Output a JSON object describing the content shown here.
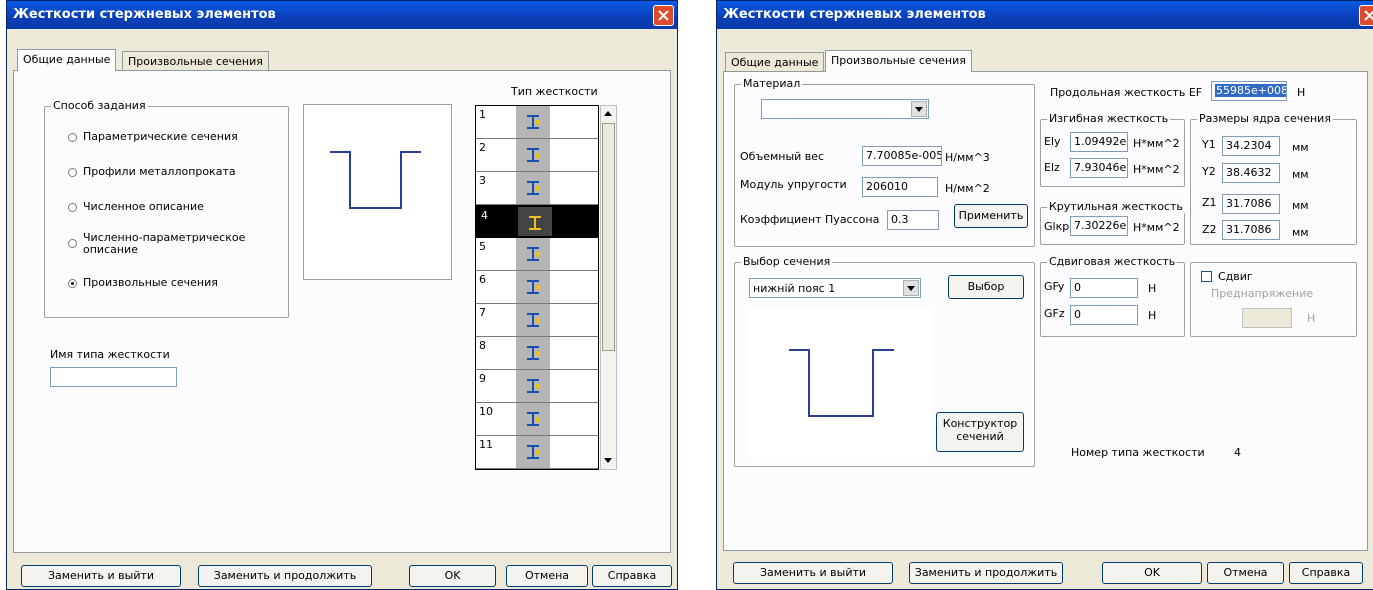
{
  "colors": {
    "title_bar": "#0a3fb8",
    "close": "#e04b2e",
    "section_line": "#2a3f9a",
    "icon_yellow": "#e8c020",
    "icon_blue": "#1a4fb0"
  },
  "left": {
    "title": "Жесткости стержневых элементов",
    "tabs": [
      "Общие данные",
      "Произвольные сечения"
    ],
    "method_group": "Способ задания",
    "options": [
      "Параметрические сечения",
      "Профили металлопроката",
      "Численное описание",
      "Численно-параметрическое",
      "описание",
      "Произвольные сечения"
    ],
    "selected_option": "Произвольные сечения",
    "type_header": "Тип жесткости",
    "rows": [
      "1",
      "2",
      "3",
      "4",
      "5",
      "6",
      "7",
      "8",
      "9",
      "10",
      "11"
    ],
    "selected_row": "4",
    "name_label": "Имя типа жесткости",
    "name_value": "",
    "buttons": {
      "replace_exit": "Заменить и выйти",
      "replace_continue": "Заменить и продолжить",
      "ok": "OK",
      "cancel": "Отмена",
      "help": "Справка"
    }
  },
  "right": {
    "title": "Жесткости стержневых элементов",
    "tabs": [
      "Общие данные",
      "Произвольные сечения"
    ],
    "material": {
      "group": "Материал",
      "selected": "",
      "volume_weight_label": "Объемный вес",
      "volume_weight": "7.70085e-005",
      "volume_weight_unit": "Н/мм^3",
      "modulus_label": "Модуль упругости",
      "modulus": "206010",
      "modulus_unit": "Н/мм^2",
      "poisson_label": "Коэффициент Пуассона",
      "poisson": "0.3",
      "apply": "Применить"
    },
    "ef_label": "Продольная жесткость EF",
    "ef_value": "55985e+008",
    "ef_unit": "Н",
    "bending": {
      "group": "Изгибная жесткость",
      "ely_label": "Ely",
      "ely": "1.09492e",
      "elz_label": "Elz",
      "elz": "7.93046e",
      "unit": "Н*мм^2"
    },
    "core": {
      "group": "Размеры ядра сечения",
      "y1_label": "Y1",
      "y1": "34.2304",
      "y2_label": "Y2",
      "y2": "38.4632",
      "z1_label": "Z1",
      "z1": "31.7086",
      "z2_label": "Z2",
      "z2": "31.7086",
      "unit": "мм"
    },
    "torsion": {
      "group": "Крутильная жесткость",
      "label": "Glкр",
      "value": "7.30226e",
      "unit": "Н*мм^2"
    },
    "section": {
      "group": "Выбор сечения",
      "selected": "нижній пояс 1",
      "choose": "Выбор",
      "designer1": "Конструктор",
      "designer2": "сечений"
    },
    "shear": {
      "group": "Сдвиговая жесткость",
      "gfy_label": "GFy",
      "gfy": "0",
      "gfz_label": "GFz",
      "gfz": "0",
      "unit": "Н"
    },
    "shift": {
      "label": "Сдвиг",
      "prestress": "Преднапряжение",
      "unit": "Н"
    },
    "type_number_label": "Номер типа жесткости",
    "type_number": "4",
    "buttons": {
      "replace_exit": "Заменить и выйти",
      "replace_continue": "Заменить и продолжить",
      "ok": "OK",
      "cancel": "Отмена",
      "help": "Справка"
    }
  }
}
